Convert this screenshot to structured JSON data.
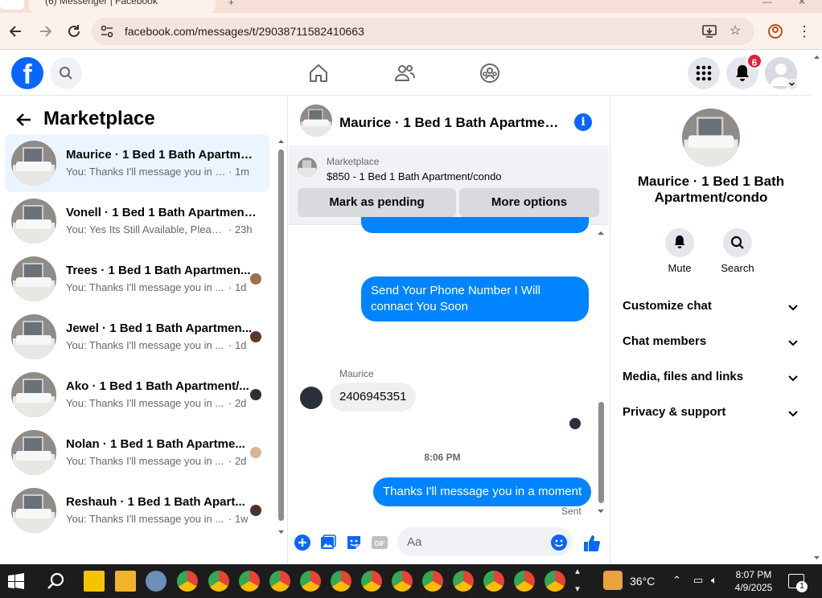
{
  "browser": {
    "tab_title": "(6) Messenger | Facebook",
    "url": "facebook.com/messages/t/29038711582410663"
  },
  "header": {
    "notification_count": "6"
  },
  "left_panel": {
    "title": "Marketplace",
    "conversations": [
      {
        "name": "Maurice · 1 Bed 1 Bath Apartmen...",
        "preview": "You: Thanks I'll message you in a ...",
        "time": "· 1m"
      },
      {
        "name": "Vonell · 1 Bed 1 Bath Apartment/...",
        "preview": "You: Yes Its Still Available, Please S...",
        "time": "· 23h"
      },
      {
        "name": "Trees · 1 Bed 1 Bath Apartmen...",
        "preview": "You: Thanks I'll message you in ...",
        "time": "· 1d"
      },
      {
        "name": "Jewel · 1 Bed 1 Bath Apartmen...",
        "preview": "You: Thanks I'll message you in ...",
        "time": "· 1d"
      },
      {
        "name": "Ako · 1 Bed 1 Bath Apartment/...",
        "preview": "You: Thanks I'll message you in ...",
        "time": "· 2d"
      },
      {
        "name": "Nolan · 1 Bed 1 Bath Apartme...",
        "preview": "You: Thanks I'll message you in ...",
        "time": "· 2d"
      },
      {
        "name": "Reshauh · 1 Bed 1 Bath Apart...",
        "preview": "You: Thanks I'll message you in ...",
        "time": "· 1w"
      }
    ]
  },
  "chat": {
    "title": "Maurice · 1 Bed 1 Bath Apartment/condo",
    "marketplace_label": "Marketplace",
    "listing": "$850 - 1 Bed 1 Bath Apartment/condo",
    "mark_pending": "Mark as pending",
    "more_options": "More options",
    "msg_out_1": "Send Your Phone Number I Will connact You Soon",
    "sender_name": "Maurice",
    "msg_in_1": "2406945351",
    "timestamp": "8:06 PM",
    "msg_out_2": "Thanks I'll message you in a moment",
    "sent_status": "Sent",
    "composer_placeholder": "Aa"
  },
  "right_panel": {
    "name": "Maurice · 1 Bed 1 Bath Apartment/condo",
    "mute_label": "Mute",
    "search_label": "Search",
    "sections": [
      "Customize chat",
      "Chat members",
      "Media, files and links",
      "Privacy & support"
    ]
  },
  "taskbar": {
    "temperature": "36°C",
    "time": "8:07 PM",
    "date": "4/9/2025",
    "notification_count": "1"
  },
  "colors": {
    "fb_blue": "#0866ff",
    "bubble_blue": "#0084ff",
    "active_row": "#ebf5ff",
    "badge_red": "#e41e3f"
  }
}
